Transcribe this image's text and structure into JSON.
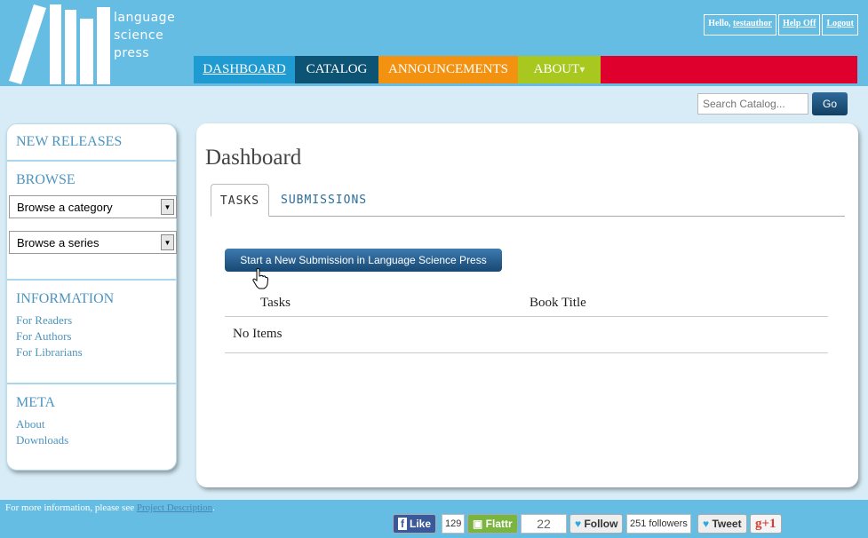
{
  "logo": {
    "line1": "language",
    "line2": "science",
    "line3": "press"
  },
  "userbar": {
    "hello_prefix": "Hello,",
    "username": "testauthor",
    "help": "Help Off",
    "logout": "Logout"
  },
  "nav": {
    "dashboard": "DASHBOARD",
    "catalog": "CATALOG",
    "announcements": "ANNOUNCEMENTS",
    "about": "ABOUT",
    "about_caret": "▾"
  },
  "search": {
    "placeholder": "Search Catalog...",
    "go": "Go"
  },
  "sidebar": {
    "new_releases": "NEW RELEASES",
    "browse": "BROWSE",
    "category_select": "Browse a category",
    "series_select": "Browse a series",
    "information": "INFORMATION",
    "info_links": [
      "For Readers",
      "For Authors",
      "For Librarians"
    ],
    "meta": "META",
    "meta_links": [
      "About",
      "Downloads"
    ]
  },
  "main": {
    "title": "Dashboard",
    "tabs": [
      "TASKS",
      "SUBMISSIONS"
    ],
    "new_submission_button": "Start a New Submission in Language Science Press",
    "columns": [
      "Tasks",
      "Book Title"
    ],
    "empty": "No Items"
  },
  "footer": {
    "text": "For more information, please see",
    "link": "Project Description",
    "like": "Like",
    "like_count": "129",
    "flattr": "Flattr",
    "flattr_count": "22",
    "follow": "Follow",
    "followers": "251 followers",
    "tweet": "Tweet",
    "gplus": "g+1"
  },
  "colors": {
    "header": "#66bde3",
    "dashboard": "#1f9bd2",
    "catalog": "#0d5373",
    "announcements": "#f39210",
    "about": "#a8c820",
    "red": "#e0002e"
  }
}
